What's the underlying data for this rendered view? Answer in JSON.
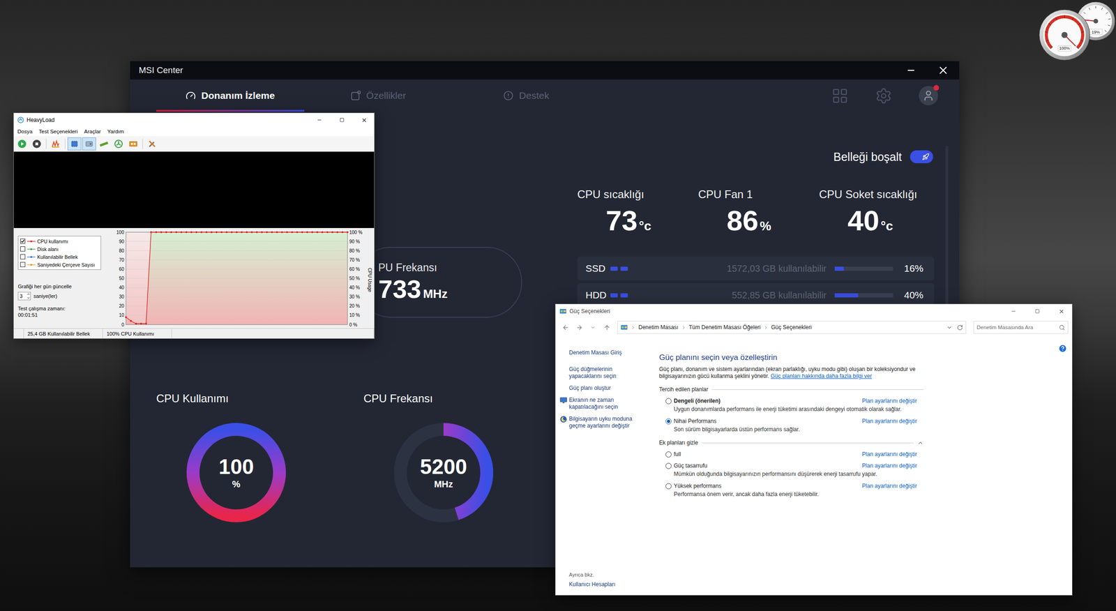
{
  "desktop": {
    "gadget": {
      "dials": [
        {
          "reading": "100%",
          "level": 1.0
        },
        {
          "reading": "19%",
          "level": 0.19
        }
      ]
    }
  },
  "msi": {
    "window": {
      "title": "MSI Center"
    },
    "tabs": [
      {
        "label": "Donanım İzleme",
        "selected": true
      },
      {
        "label": "Özellikler",
        "selected": false
      },
      {
        "label": "Destek",
        "selected": false
      }
    ],
    "free_memory": {
      "label": "Belleği boşalt",
      "on": true
    },
    "stats": [
      {
        "label": "CPU sıcaklığı",
        "value": "73",
        "unit": "°c"
      },
      {
        "label": "CPU Fan 1",
        "value": "86",
        "unit": "%"
      },
      {
        "label": "CPU Soket sıcaklığı",
        "value": "40",
        "unit": "°c"
      }
    ],
    "drives": [
      {
        "name": "SSD",
        "available": "1572,03 GB kullanılabilir",
        "level": 0.16,
        "reading": "16%"
      },
      {
        "name": "HDD",
        "available": "552,85 GB kullanılabilir",
        "level": 0.4,
        "reading": "40%"
      }
    ],
    "frequency_card": {
      "label": "PU Frekansı",
      "value": "733",
      "unit": "MHz"
    },
    "gauges": [
      {
        "label": "CPU Kullanımı",
        "value": "100",
        "unit": "%",
        "level": 1.0
      },
      {
        "label": "CPU Frekansı",
        "value": "5200",
        "unit": "MHz",
        "level": 0.45
      }
    ]
  },
  "heavyload": {
    "window": {
      "title": "HeavyLoad"
    },
    "menu": [
      "Dosya",
      "Test Seçenekleri",
      "Araçlar",
      "Yardım"
    ],
    "toolbar": [
      {
        "kind": "play",
        "pressed": false
      },
      {
        "kind": "stop",
        "pressed": false
      },
      {
        "kind": "separator"
      },
      {
        "kind": "stress",
        "pressed": false
      },
      {
        "kind": "separator"
      },
      {
        "kind": "cpu",
        "pressed": true
      },
      {
        "kind": "disk",
        "pressed": true
      },
      {
        "kind": "memory",
        "pressed": false
      },
      {
        "kind": "fan",
        "pressed": false
      },
      {
        "kind": "gpu",
        "pressed": false
      },
      {
        "kind": "separator"
      },
      {
        "kind": "tools",
        "pressed": false
      }
    ],
    "legend": [
      {
        "label": "CPU kullanımı",
        "checked": true,
        "color": "#e02020"
      },
      {
        "label": "Disk alanı",
        "checked": false,
        "color": "#2f9e3a"
      },
      {
        "label": "Kullanılabilir Bellek",
        "checked": false,
        "color": "#2f6fd0"
      },
      {
        "label": "Saniyedeki Çerçeve Sayısı",
        "checked": false,
        "color": "#e8921e"
      }
    ],
    "update": {
      "label": "Grafiği her gün güncelle",
      "value": "3",
      "unit": "saniye(ler)"
    },
    "runtime": {
      "label": "Test çalışma zamanı:",
      "value": "00:01:51"
    },
    "chart": {
      "axis_label": "CPU Usage",
      "left_ticks": [
        "100",
        "90",
        "80",
        "70",
        "60",
        "50",
        "40",
        "30",
        "20",
        "10",
        "0"
      ],
      "right_ticks": [
        "100 %",
        "90 %",
        "80 %",
        "70 %",
        "60 %",
        "50 %",
        "40 %",
        "30 %",
        "20 %",
        "10 %",
        "0 %"
      ],
      "series": [
        {
          "name": "CPU kullanımı",
          "values": [
            8,
            4,
            1,
            1,
            1,
            100,
            100,
            100,
            100,
            100,
            100,
            100,
            100,
            100,
            100,
            100,
            100,
            100,
            100,
            100,
            100,
            100,
            100,
            100,
            100,
            100,
            100,
            100,
            100,
            100,
            100,
            100,
            100,
            100,
            100,
            100,
            100,
            100,
            100,
            100,
            100,
            100,
            100,
            100,
            100
          ]
        }
      ]
    },
    "status_bar": [
      "25,4 GB Kullanılabilir Bellek",
      "100% CPU Kullanımı"
    ]
  },
  "power_options": {
    "window": {
      "title": "Güç Seçenekleri"
    },
    "breadcrumb": [
      "Denetim Masası",
      "Tüm Denetim Masası Öğeleri",
      "Güç Seçenekleri"
    ],
    "search": {
      "placeholder": "Denetim Masasında Ara"
    },
    "sidebar": {
      "items": [
        {
          "label": "Denetim Masası Giriş",
          "kind": "link"
        },
        {
          "label": "Güç düğmelerinin yapacaklarını seçin",
          "kind": "link"
        },
        {
          "label": "Güç planı oluştur",
          "kind": "link"
        },
        {
          "label": "Ekranın ne zaman kapatılacağını seçin",
          "kind": "screen"
        },
        {
          "label": "Bilgisayarın uyku moduna geçme ayarlarını değiştir",
          "kind": "sleep"
        }
      ],
      "see_also": {
        "label": "Ayrıca bkz.",
        "links": [
          "Kullanıcı Hesapları"
        ]
      }
    },
    "heading": "Güç planını seçin veya özelleştirin",
    "description": "Güç planı, donanım ve sistem ayarlarından (ekran parlaklığı, uyku modu gibi) oluşan bir koleksiyondur ve bilgisayarınızın gücü kullanma şeklini yönetir.",
    "learn_more": "Güç planları hakkında daha fazla bilgi ver",
    "sections": [
      {
        "title": "Tercih edilen planlar",
        "plans": [
          {
            "name": "Dengeli (önerilen)",
            "description": "Uygun donanımlarda performans ile enerji tüketimi arasındaki dengeyi otomatik olarak sağlar.",
            "selected": false,
            "recommended": true,
            "link": "Plan ayarlarını değiştir"
          },
          {
            "name": "Nihai Performans",
            "description": "Son sürüm bilgisayarlarda üstün performans sağlar.",
            "selected": true,
            "recommended": false,
            "link": "Plan ayarlarını değiştir"
          }
        ]
      },
      {
        "title": "Ek planları gizle",
        "expanded": true,
        "plans": [
          {
            "name": "full",
            "selected": false,
            "recommended": false,
            "link": "Plan ayarlarını değiştir"
          },
          {
            "name": "Güç tasarrufu",
            "description": "Mümkün olduğunda bilgisayarınızın performansını düşürerek enerji tasarrufu yapar.",
            "selected": false,
            "recommended": false,
            "link": "Plan ayarlarını değiştir"
          },
          {
            "name": "Yüksek performans",
            "description": "Performansa önem verir, ancak daha fazla enerji tüketebilir.",
            "selected": false,
            "recommended": false,
            "link": "Plan ayarlarını değiştir"
          }
        ]
      }
    ]
  }
}
